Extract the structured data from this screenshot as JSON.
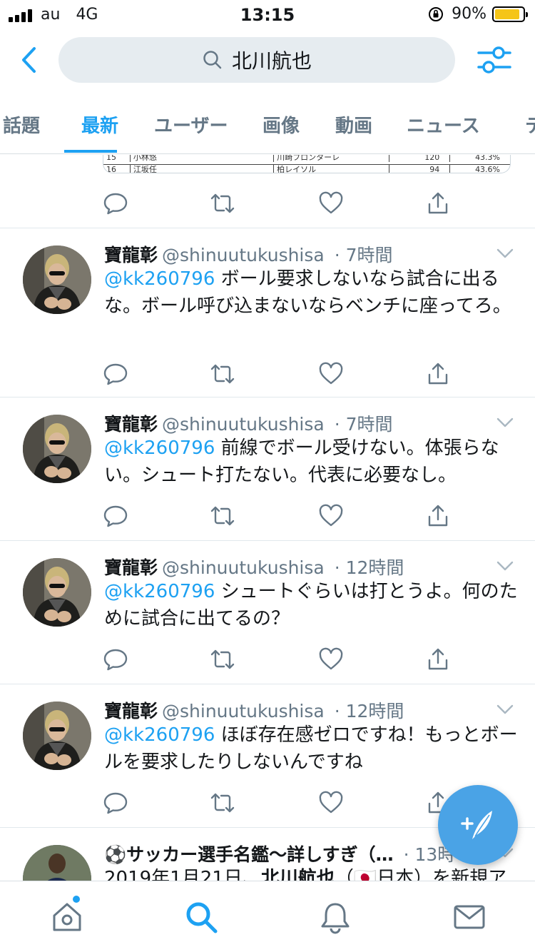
{
  "status_bar": {
    "carrier": "au",
    "network": "4G",
    "time": "13:15",
    "battery": "90%",
    "battery_level": 0.9
  },
  "search": {
    "query": "北川航也"
  },
  "tabs": [
    {
      "label": "話題"
    },
    {
      "label": "最新"
    },
    {
      "label": "ユーザー"
    },
    {
      "label": "画像"
    },
    {
      "label": "動画"
    },
    {
      "label": "ニュース"
    },
    {
      "label": "テ"
    }
  ],
  "top_fragment": {
    "rows": [
      [
        "15",
        "小林悠",
        "川崎フロンターレ",
        "120",
        "43.3%"
      ],
      [
        "16",
        "江坂任",
        "柏レイソル",
        "94",
        "43.6%"
      ]
    ]
  },
  "tweets": [
    {
      "name": "寶龍彰",
      "handle": "@shinuutukushisa",
      "time": "· 7時間",
      "mention": "@kk260796",
      "text": "ボール要求しないなら試合に出るな。ボール呼び込まないならベンチに座ってろ。"
    },
    {
      "name": "寶龍彰",
      "handle": "@shinuutukushisa",
      "time": "· 7時間",
      "mention": "@kk260796",
      "text": "前線でボール受けない。体張らない。シュート打たない。代表に必要なし。"
    },
    {
      "name": "寶龍彰",
      "handle": "@shinuutukushisa",
      "time": "· 12時間",
      "mention": "@kk260796",
      "text": "シュートぐらいは打とうよ。何のために試合に出てるの？"
    },
    {
      "name": "寶龍彰",
      "handle": "@shinuutukushisa",
      "time": "· 12時間",
      "mention": "@kk260796",
      "text": "ほぼ存在感ゼロですね！もっとボールを要求したりしないんですね"
    }
  ],
  "last_tweet": {
    "name": "⚽サッカー選手名鑑〜詳しすぎ（…",
    "time": "· 13時",
    "text_prefix": "2019年1月21日、",
    "text_bold": "北川航也",
    "text_suffix": "（🇯🇵日本）を新規ア"
  },
  "colors": {
    "accent": "#1da1f2",
    "secondary_text": "#657786",
    "fab": "#4aa3e6"
  },
  "icons": [
    "back-icon",
    "search-icon",
    "filter-icon",
    "reply-icon",
    "retweet-icon",
    "like-icon",
    "share-icon",
    "compose-icon",
    "home-icon",
    "explore-icon",
    "notifications-icon",
    "messages-icon"
  ]
}
